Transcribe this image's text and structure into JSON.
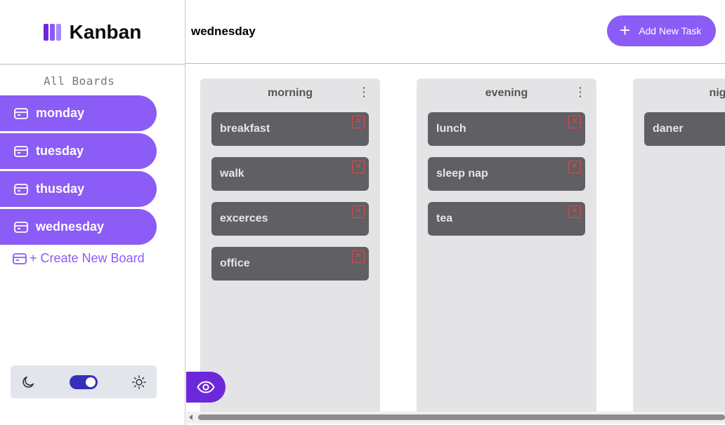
{
  "app": {
    "logo_text": "Kanban",
    "logo_colors": [
      "#6d28d9",
      "#8b5cf6",
      "#a78bfa"
    ]
  },
  "header": {
    "board_title": "wednesday",
    "add_task_label": "Add New Task",
    "add_task_icon": "plus-icon"
  },
  "sidebar": {
    "section_label": "All Boards",
    "boards": [
      {
        "label": "monday",
        "icon": "board-icon"
      },
      {
        "label": "tuesday",
        "icon": "board-icon"
      },
      {
        "label": "thusday",
        "icon": "board-icon"
      },
      {
        "label": "wednesday",
        "icon": "board-icon"
      }
    ],
    "create_label": "+ Create New Board",
    "theme": {
      "dark_icon": "moon-icon",
      "light_icon": "sun-icon",
      "toggle_on": true
    }
  },
  "columns": [
    {
      "title": "morning",
      "tasks": [
        "breakfast",
        "walk",
        "excerces",
        "office"
      ]
    },
    {
      "title": "evening",
      "tasks": [
        "lunch",
        "sleep nap",
        "tea"
      ]
    },
    {
      "title": "night",
      "tasks": [
        "daner"
      ]
    }
  ],
  "colors": {
    "accent": "#8b5cf6",
    "accent_dark": "#6d28d9",
    "task_bg": "#5f5f64",
    "column_bg": "#e4e4e7",
    "delete_red": "#e04848"
  }
}
